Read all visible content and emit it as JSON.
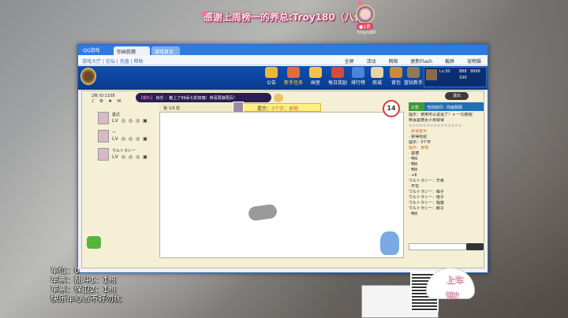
{
  "overlay": {
    "thanks": "感谢上周榜一的养总:Troy180（八骨）",
    "rank_badge": "●1名",
    "rank_name": "troy180",
    "side_lines": [
      "上车",
      "鸭！"
    ],
    "left_info": [
      "车位：0",
      "车票：乱斗1：1鸭",
      "车票：保卫2：1鸭",
      "快乐车心态不好勿扰"
    ]
  },
  "window": {
    "app_title": "QQ游戏",
    "tabs": [
      "你画我猜",
      "游戏首页"
    ],
    "menu_left": "游戏大厅 | 论坛 | 充值 | 帮助",
    "menu_right": [
      "全屏",
      "活动",
      "网络",
      "更新Flash",
      "截屏",
      "宠物猫"
    ]
  },
  "header": {
    "buttons": [
      {
        "id": "gongao",
        "label": "公告",
        "color": "#e8b93a",
        "hot": false
      },
      {
        "id": "xinren",
        "label": "新手任务",
        "color": "#e86a3a",
        "hot": true
      },
      {
        "id": "tuhuashi",
        "label": "画室",
        "color": "#f2c34a",
        "hot": false
      },
      {
        "id": "meiri",
        "label": "每日奖励",
        "color": "#d64a3a",
        "hot": false
      },
      {
        "id": "paihang",
        "label": "排行榜",
        "color": "#4a86d6",
        "hot": false
      },
      {
        "id": "shangcheng",
        "label": "商城",
        "color": "#e8d2a8",
        "hot": false
      },
      {
        "id": "beibao",
        "label": "背包",
        "color": "#c98b3a",
        "hot": false
      },
      {
        "id": "rank",
        "label": "蓝钻新手",
        "color": "#8f7a5a",
        "hot": false
      }
    ],
    "user_stats": [
      "Lv:30",
      "888",
      "9999",
      "100"
    ]
  },
  "room": {
    "number": "2房 ID:1108",
    "icons": "♪ ⚙ ★ ✉",
    "ticker_tag": "【喇叭】",
    "ticker_text": "快乐 ：戴上了99朵七彩玫瑰！恭喜再接再厉！"
  },
  "players": [
    {
      "name": "曼达",
      "meta": "LV ◎ ◎ ◎ ▣"
    },
    {
      "name": "一",
      "meta": "LV ◎ ◎ ◎ ▣"
    },
    {
      "name": "ウルトラシー",
      "meta": "LV ◎ ◎ ◎ ▣"
    }
  ],
  "canvas": {
    "who": "第 1/6 轮",
    "hint_label": "提示：",
    "hint_value": "3个字，食物",
    "timer": "14"
  },
  "chat": {
    "tab_main": "公告",
    "tab_room": "当前房间：你画我猜",
    "exit_label": "退出",
    "lines": [
      {
        "t": "提示：使用可以说话了！+·一同答题",
        "hl": false
      },
      {
        "t": "恭喜曼德太小米获得",
        "hl": false
      },
      {
        "t": "☆☆☆☆☆☆☆☆☆☆☆☆☆☆☆",
        "hl": false
      },
      {
        "t": "· 获得金币",
        "hl": true
      },
      {
        "t": "· 获得经验",
        "hl": false
      },
      {
        "t": "提示：3个字",
        "hl": false
      },
      {
        "t": "提示：食物",
        "hl": true
      },
      {
        "t": "· 曼德",
        "hl": false
      },
      {
        "t": "· 鸭6",
        "hl": false
      },
      {
        "t": "· 鸭6",
        "hl": false
      },
      {
        "t": "· 鸭6",
        "hl": false
      },
      {
        "t": "· +6",
        "hl": false
      },
      {
        "t": "ウルトラシー：芒果",
        "hl": false
      },
      {
        "t": "· 开花",
        "hl": false
      },
      {
        "t": "ウルトラシー：橘子",
        "hl": false
      },
      {
        "t": "ウルトラシー：橙子",
        "hl": false
      },
      {
        "t": "ウルトラシー：榴莲",
        "hl": false
      },
      {
        "t": "ウルトラシー：椰子",
        "hl": false
      },
      {
        "t": "· 鸭6",
        "hl": false
      }
    ]
  }
}
